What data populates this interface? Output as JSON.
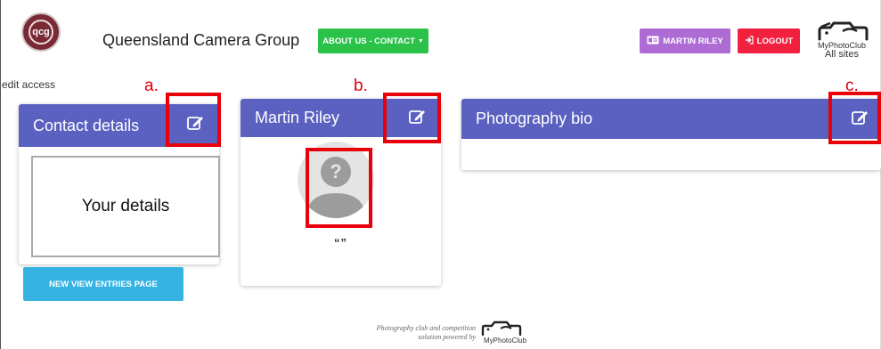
{
  "header": {
    "logo_text": "qcg",
    "site_title": "Queensland Camera Group",
    "about_button": "ABOUT US - CONTACT",
    "user_button": "MARTIN RILEY",
    "logout_button": "LOGOUT",
    "brand_name": "MyPhotoClub",
    "brand_sub": "All sites"
  },
  "edit_access": "edit access",
  "markers": {
    "a": "a.",
    "b": "b.",
    "c": "c."
  },
  "contact_card": {
    "title": "Contact details",
    "details_placeholder": "Your details"
  },
  "profile_card": {
    "name": "Martin Riley",
    "quote": "“”"
  },
  "bio_card": {
    "title": "Photography bio"
  },
  "entries_button": "NEW VIEW ENTRIES PAGE",
  "footer": {
    "line1": "Photography club and competition",
    "line2": "solution powered by",
    "brand": "MyPhotoClub"
  },
  "colors": {
    "card_header": "#5b61c0",
    "about_button": "#2bc24a",
    "user_button": "#ad6bd3",
    "logout_button": "#f2203f",
    "entries_button": "#35b4e4",
    "highlight": "#e8000b"
  }
}
